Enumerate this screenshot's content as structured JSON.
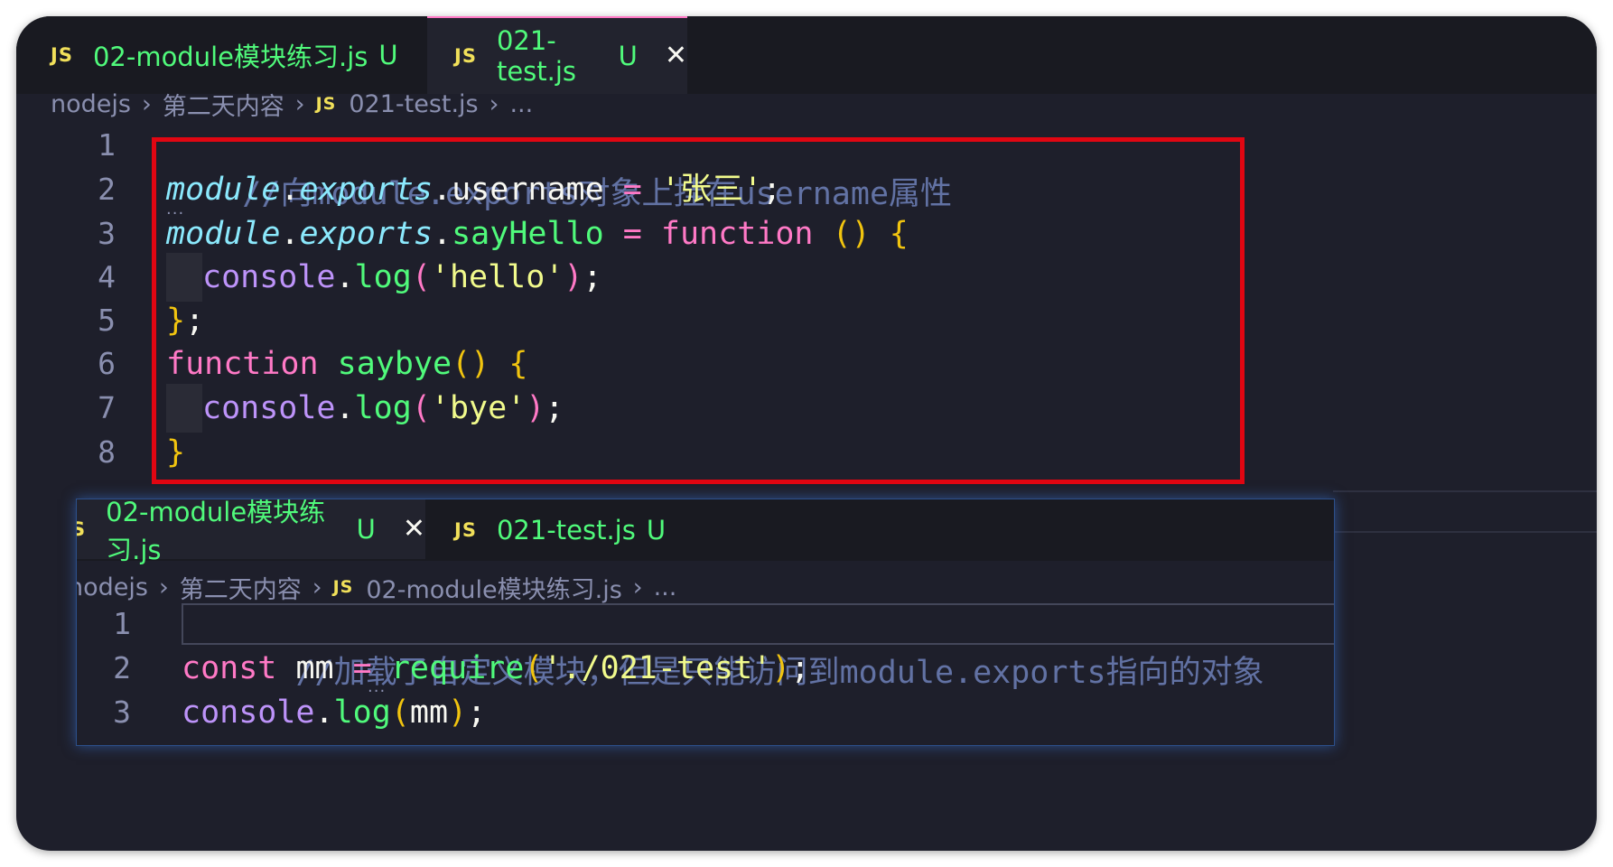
{
  "editor_top": {
    "tabs": [
      {
        "label": "02-module模块练习.js",
        "badge": "JS",
        "status": "U"
      },
      {
        "label": "021-test.js",
        "badge": "JS",
        "status": "U",
        "close": "✕"
      }
    ],
    "breadcrumb": {
      "folder": "nodejs",
      "subfolder": "第二天内容",
      "badge": "JS",
      "file": "021-test.js",
      "more": "..."
    },
    "line_numbers": [
      "1",
      "2",
      "3",
      "4",
      "5",
      "6",
      "7",
      "8"
    ],
    "lines": {
      "l1": "//向module.exports对象上挂在username属性",
      "l2": {
        "obj": "module",
        "dot1": ".",
        "exports": "exports",
        "dot2": ".",
        "prop": "username",
        "eq": " = ",
        "str": "'张三'",
        "end": ";"
      },
      "l3": {
        "obj": "module",
        "dot1": ".",
        "exports": "exports",
        "dot2": ".",
        "fn": "sayHello",
        "eq": " = ",
        "kw": "function",
        "sp": " ",
        "parens": "()",
        "sp2": " ",
        "brace": "{"
      },
      "l4": {
        "console": "console",
        "dot": ".",
        "fn": "log",
        "open": "(",
        "str": "'hello'",
        "close": ")",
        "end": ";"
      },
      "l5": {
        "brace": "}",
        "end": ";"
      },
      "l6": {
        "kw": "function",
        "sp": " ",
        "fn": "saybye",
        "parens": "()",
        "sp2": " ",
        "brace": "{"
      },
      "l7": {
        "console": "console",
        "dot": ".",
        "fn": "log",
        "open": "(",
        "str": "'bye'",
        "close": ")",
        "end": ";"
      },
      "l8": {
        "brace": "}"
      }
    }
  },
  "editor_bottom": {
    "tabs": [
      {
        "label": "02-module模块练习.js",
        "badge": "S",
        "status": "U",
        "close": "✕"
      },
      {
        "label": "021-test.js",
        "badge": "JS",
        "status": "U"
      }
    ],
    "breadcrumb": {
      "folder": "nodejs",
      "subfolder": "第二天内容",
      "badge": "JS",
      "file": "02-module模块练习.js",
      "more": "..."
    },
    "line_numbers": [
      "1",
      "2",
      "3"
    ],
    "lines": {
      "l1": "//加载了自定义模块，但是只能访问到module.exports指向的对象",
      "l2": {
        "kw": "const",
        "sp": " ",
        "var": "mm",
        "eq": " = ",
        "fn": "require",
        "open": "(",
        "str": "'./021-test'",
        "close": ")",
        "end": ";"
      },
      "l3": {
        "console": "console",
        "dot": ".",
        "fn": "log",
        "open": "(",
        "arg": "mm",
        "close": ")",
        "end": ";"
      }
    }
  },
  "annotation": {
    "color": "#e10612"
  },
  "colors": {
    "background": "#1e1f2b",
    "comment": "#6272a4",
    "keyword": "#ff79c6",
    "function": "#50fa7b",
    "string": "#f1fa8c",
    "object": "#8be9fd"
  }
}
